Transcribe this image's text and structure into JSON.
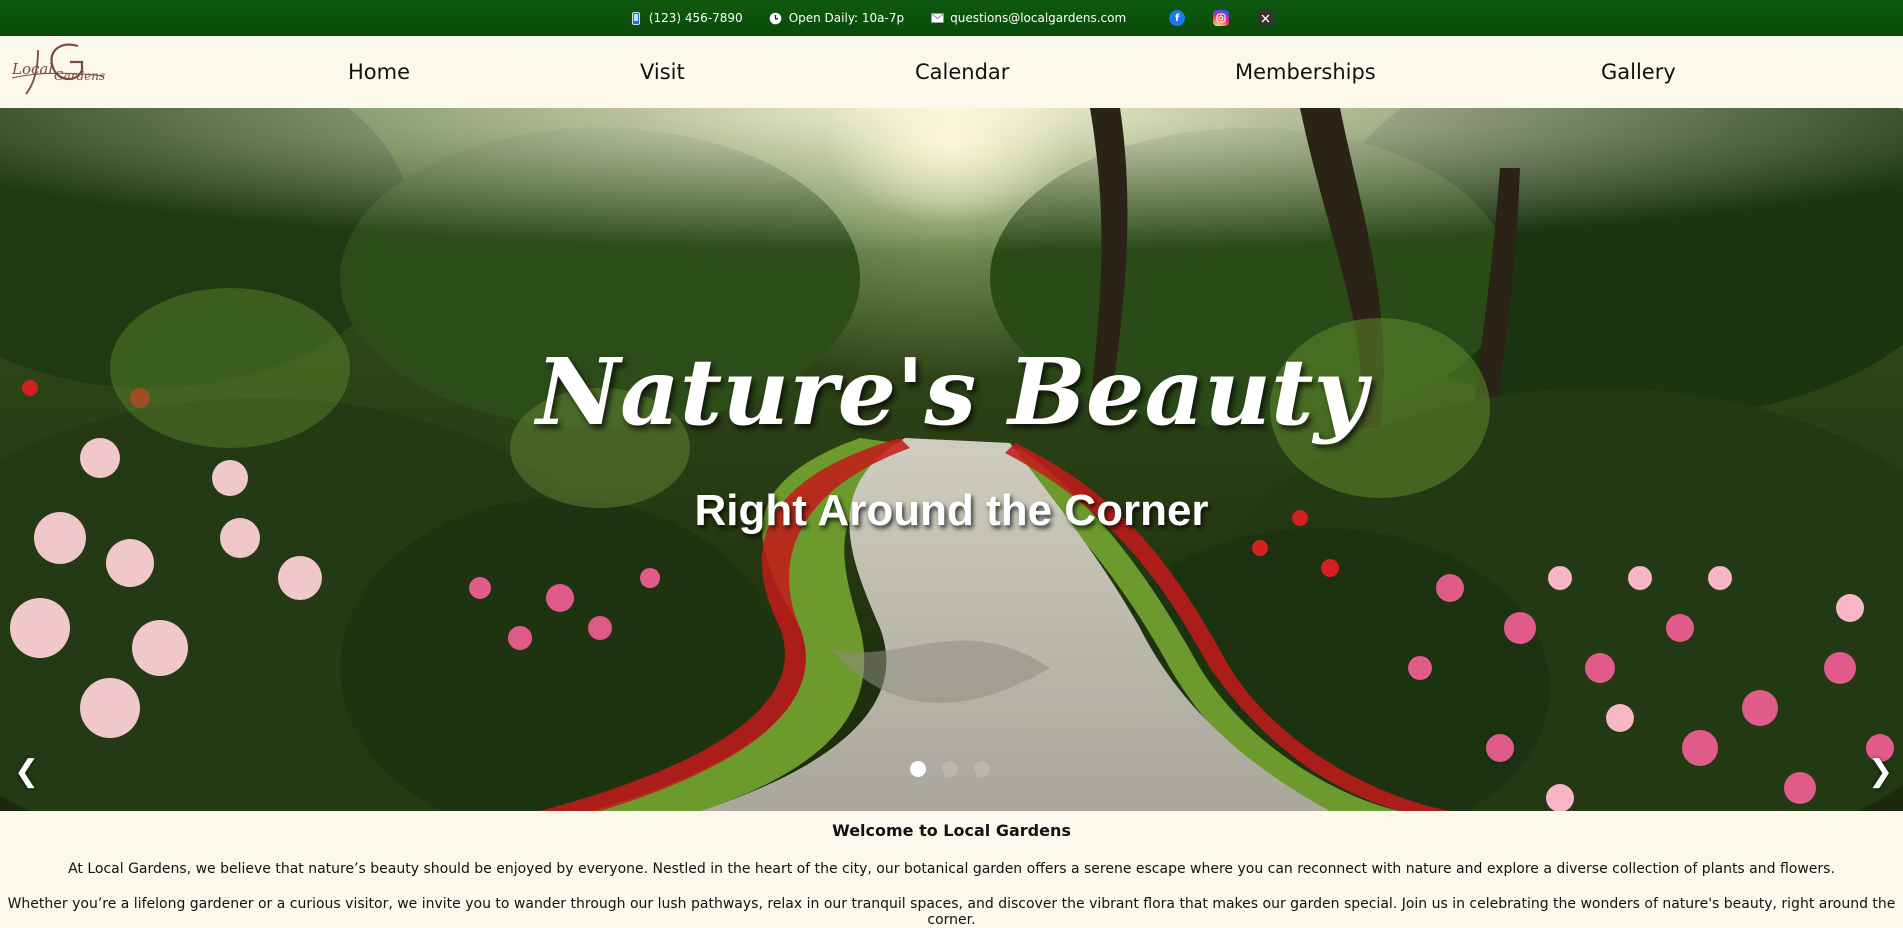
{
  "topbar": {
    "phone": "(123) 456-7890",
    "hours": "Open Daily: 10a-7p",
    "email": "questions@localgardens.com",
    "social": [
      "facebook-icon",
      "instagram-icon",
      "x-icon"
    ]
  },
  "logo": {
    "text_line1": "Local",
    "text_line2": "Gardens",
    "monogram": "G"
  },
  "nav": {
    "items": [
      "Home",
      "Visit",
      "Calendar",
      "Memberships",
      "Gallery"
    ]
  },
  "hero": {
    "title": "Nature's Beauty",
    "subtitle": "Right Around the Corner",
    "prev": "❮",
    "next": "❯",
    "slides": 3,
    "active_slide": 1
  },
  "content": {
    "heading": "Welcome to Local Gardens",
    "paragraph1": "At Local Gardens, we believe that nature’s beauty should be enjoyed by everyone. Nestled in the heart of the city, our botanical garden offers a serene escape where you can reconnect with nature and explore a diverse collection of plants and flowers.",
    "paragraph2": "Whether you’re a lifelong gardener or a curious visitor, we invite you to wander through our lush pathways, relax in our tranquil spaces, and discover the vibrant flora that makes our garden special. Join us in celebrating the wonders of nature's beauty, right around the corner."
  },
  "colors": {
    "topbar": "#0a4a0a",
    "page_bg": "#fdf8ec",
    "text": "#111111",
    "logo": "#7a4a40"
  }
}
